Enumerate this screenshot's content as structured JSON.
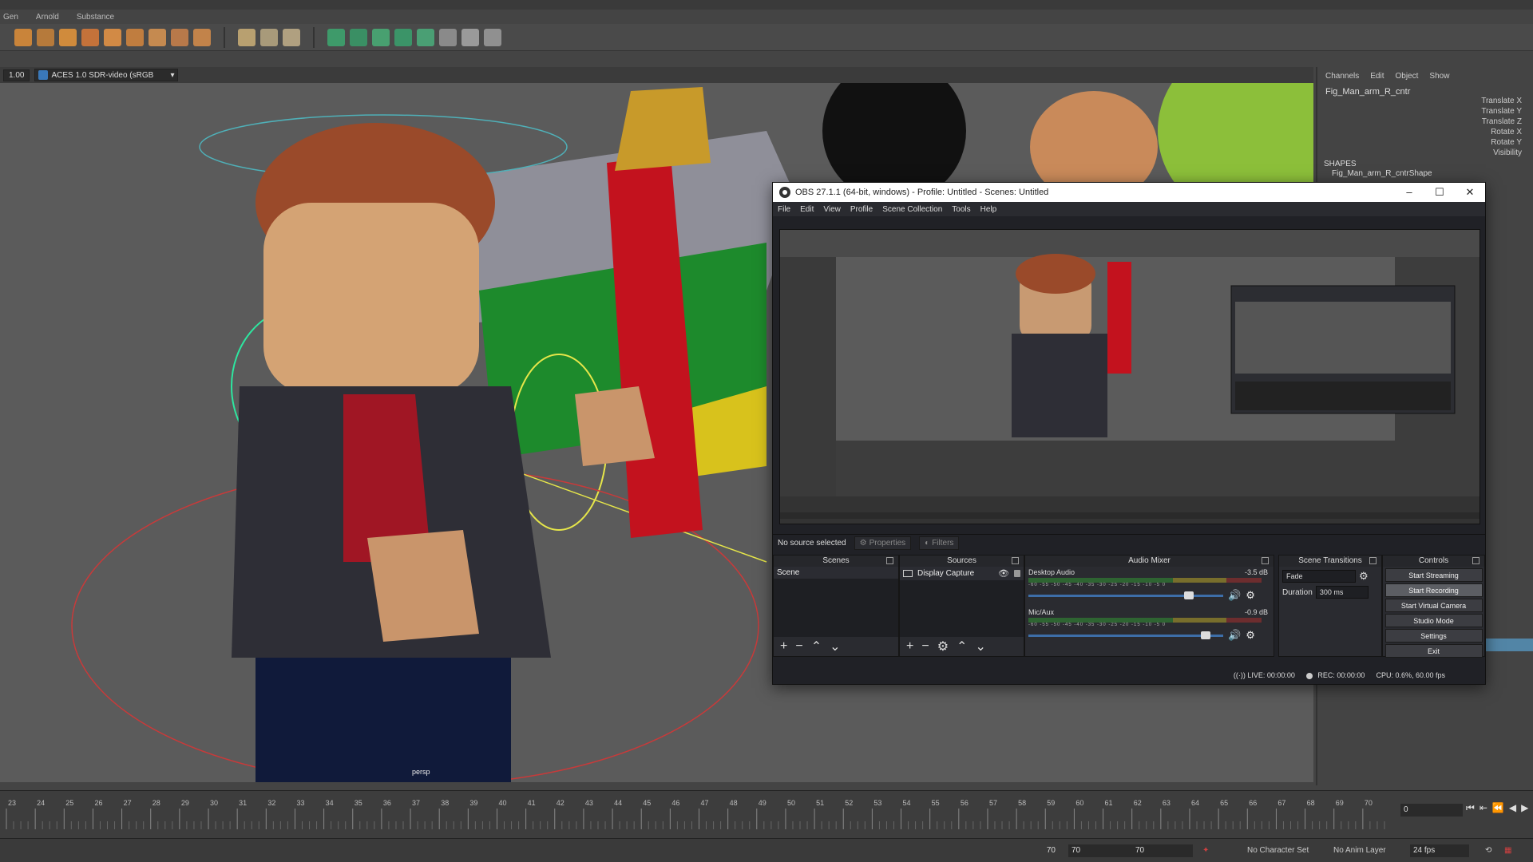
{
  "maya": {
    "shelf_tabs": [
      "Gen",
      "Arnold",
      "Substance"
    ],
    "viewport_header": {
      "exposure": "1.00",
      "color_space": "ACES 1.0 SDR-video (sRGB"
    },
    "camera_label": "persp",
    "channel_box": {
      "menu": [
        "Channels",
        "Edit",
        "Object",
        "Show"
      ],
      "object_name": "Fig_Man_arm_R_cntr",
      "attributes": [
        "Translate X",
        "Translate Y",
        "Translate Z",
        "Rotate X",
        "Rotate Y",
        "Visibility"
      ],
      "shapes_header": "SHAPES",
      "shape_name": "Fig_Man_arm_R_cntrShape"
    },
    "timeline": {
      "ticks": [
        "23",
        "24",
        "25",
        "26",
        "27",
        "28",
        "29",
        "30",
        "31",
        "32",
        "33",
        "34",
        "35",
        "36",
        "37",
        "38",
        "39",
        "40",
        "41",
        "42",
        "43",
        "44",
        "45",
        "46",
        "47",
        "48",
        "49",
        "50",
        "51",
        "52",
        "53",
        "54",
        "55",
        "56",
        "57",
        "58",
        "59",
        "60",
        "61",
        "62",
        "63",
        "64",
        "65",
        "66",
        "67",
        "68",
        "69",
        "70"
      ],
      "current_frame": "0"
    },
    "range_bar": {
      "end_left": "70",
      "range_start": "70",
      "range_end": "70",
      "character_set": "No Character Set",
      "anim_layer": "No Anim Layer",
      "fps": "24 fps"
    }
  },
  "obs": {
    "title": "OBS 27.1.1 (64-bit, windows) - Profile: Untitled - Scenes: Untitled",
    "menu": [
      "File",
      "Edit",
      "View",
      "Profile",
      "Scene Collection",
      "Tools",
      "Help"
    ],
    "source_status": "No source selected",
    "properties_label": "Properties",
    "filters_label": "Filters",
    "docks": {
      "scenes": {
        "title": "Scenes",
        "items": [
          "Scene"
        ]
      },
      "sources": {
        "title": "Sources",
        "items": [
          "Display Capture"
        ]
      },
      "mixer": {
        "title": "Audio Mixer",
        "channels": [
          {
            "name": "Desktop Audio",
            "level": "-3.5 dB",
            "volume": 0.84
          },
          {
            "name": "Mic/Aux",
            "level": "-0.9 dB",
            "volume": 0.93
          }
        ],
        "scale": "-60 -55 -50 -45 -40 -35 -30 -25 -20 -15 -10 -5 0"
      },
      "transitions": {
        "title": "Scene Transitions",
        "transition": "Fade",
        "duration_label": "Duration",
        "duration": "300 ms"
      },
      "controls": {
        "title": "Controls",
        "buttons": [
          "Start Streaming",
          "Start Recording",
          "Start Virtual Camera",
          "Studio Mode",
          "Settings",
          "Exit"
        ]
      }
    },
    "status": {
      "live": "LIVE: 00:00:00",
      "rec": "REC: 00:00:00",
      "cpu": "CPU: 0.6%, 60.00 fps"
    }
  }
}
